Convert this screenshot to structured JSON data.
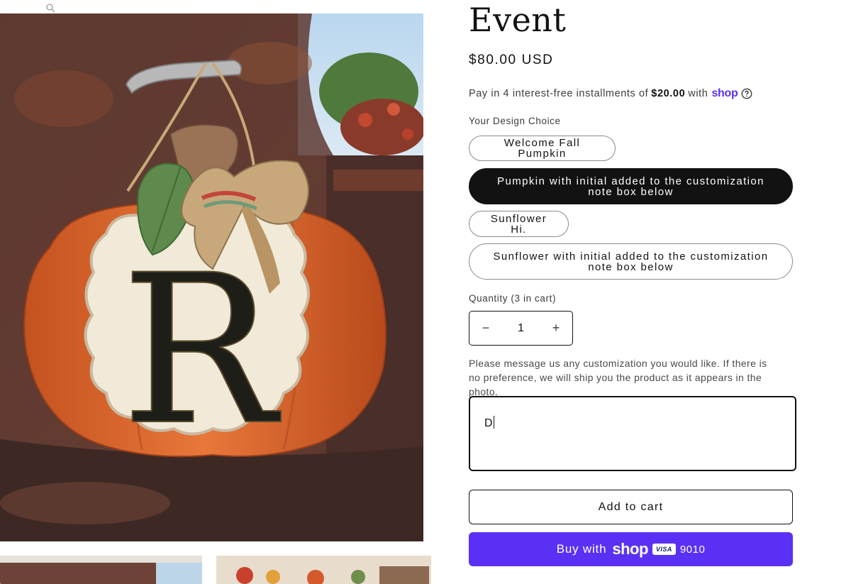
{
  "product": {
    "title": "Event",
    "price": "$80.00 USD"
  },
  "installments": {
    "prefix": "Pay in 4 interest-free installments of",
    "amount": "$20.00",
    "with": "with",
    "brand": "shop"
  },
  "design_option": {
    "legend": "Your Design Choice",
    "choices": [
      {
        "label": "Welcome Fall Pumpkin",
        "selected": false
      },
      {
        "label": "Pumpkin with initial added to the customization note box below",
        "selected": true
      },
      {
        "label": "Sunflower Hi.",
        "selected": false
      },
      {
        "label": "Sunflower with initial added to the customization note box below",
        "selected": false
      }
    ]
  },
  "quantity": {
    "label": "Quantity (3 in cart)",
    "value": "1",
    "minus": "−",
    "plus": "+"
  },
  "note": {
    "instructions": "Please message us any customization you would like. If there is no preference, we will ship you the product as it appears in the photo.",
    "value": "D"
  },
  "buttons": {
    "add_to_cart": "Add to cart",
    "buy_with": "Buy with",
    "shop_logo": "shop",
    "card_brand": "VISA",
    "card_last4": "9010"
  },
  "image": {
    "initial_letter": "R"
  },
  "colors": {
    "accent_shop": "#5a31f4",
    "selected_pill": "#121212",
    "pumpkin": "#d9652a",
    "rust": "#6b3a2c"
  }
}
